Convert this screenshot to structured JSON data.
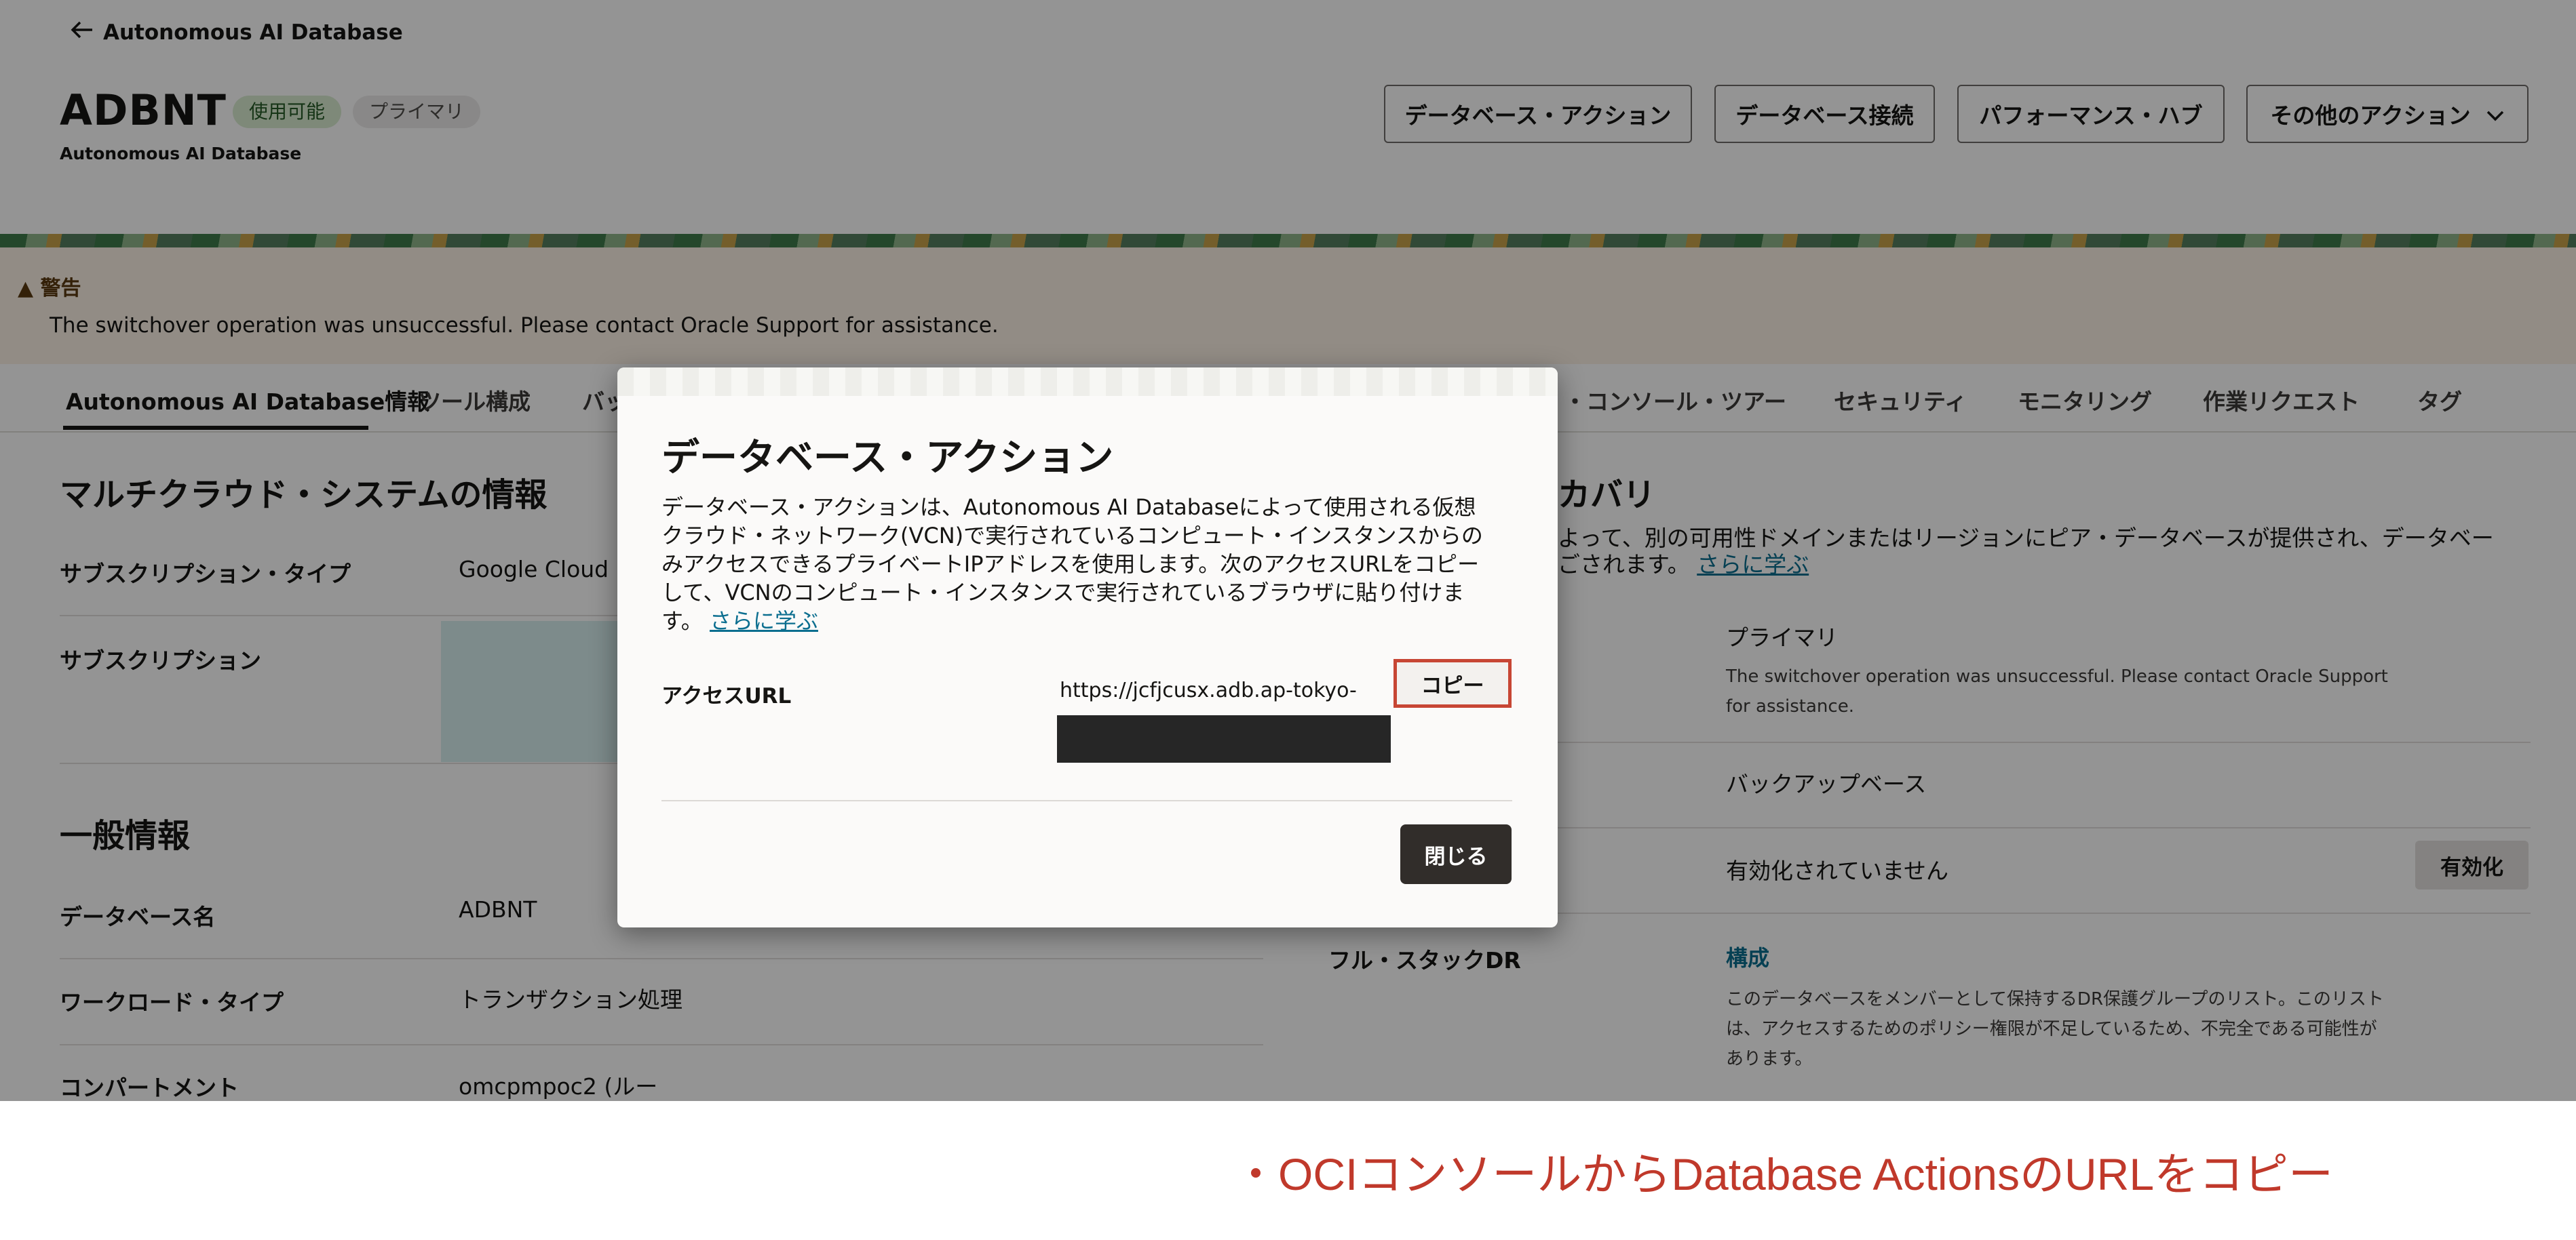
{
  "header": {
    "back_label": "Autonomous AI Database",
    "title": "ADBNT",
    "status_badge": "使用可能",
    "role_badge": "プライマリ",
    "subtitle": "Autonomous AI Database",
    "actions": [
      "データベース・アクション",
      "データベース接続",
      "パフォーマンス・ハブ",
      "その他のアクション"
    ]
  },
  "warning": {
    "title": "警告",
    "message": "The switchover operation was unsuccessful. Please contact Oracle Support for assistance."
  },
  "tabs": [
    "Autonomous AI Database情報",
    "ツール構成",
    "バッ",
    "・コンソール・ツアー",
    "セキュリティ",
    "モニタリング",
    "作業リクエスト",
    "タグ"
  ],
  "left_panel": {
    "multicloud_heading": "マルチクラウド・システムの情報",
    "subscription_type_label": "サブスクリプション・タイプ",
    "subscription_type_value": "Google Cloud",
    "subscription_label": "サブスクリプション",
    "general_heading": "一般情報",
    "rows": [
      {
        "label": "データベース名",
        "value": "ADBNT"
      },
      {
        "label": "ワークロード・タイプ",
        "value": "トランザクション処理"
      },
      {
        "label": "コンパートメント",
        "value": "omcpmpoc2 (ルー"
      }
    ]
  },
  "right_panel": {
    "heading_partial": "カバリ",
    "desc_line1": "よって、別の可用性ドメインまたはリージョンにピア・データベースが提供され、データベー",
    "desc_line2": "ごされます。",
    "learn_more": "さらに学ぶ",
    "role_value": "プライマリ",
    "role_note": "The switchover operation was unsuccessful. Please contact Oracle Support for assistance.",
    "backup_value": "バックアップベース",
    "disabled_value": "有効化されていません",
    "enable_button": "有効化",
    "fullstack_label": "フル・スタックDR",
    "fullstack_link": "構成",
    "fullstack_note": "このデータベースをメンバーとして保持するDR保護グループのリスト。このリストは、アクセスするためのポリシー権限が不足しているため、不完全である可能性があります。"
  },
  "modal": {
    "title": "データベース・アクション",
    "description": "データベース・アクションは、Autonomous AI Databaseによって使用される仮想クラウド・ネットワーク(VCN)で実行されているコンピュート・インスタンスからのみアクセスできるプライベートIPアドレスを使用します。次のアクセスURLをコピーして、VCNのコンピュート・インスタンスで実行されているブラウザに貼り付けます。",
    "learn_more": "さらに学ぶ",
    "access_url_label": "アクセスURL",
    "access_url_value": "https://jcfjcusx.adb.ap-tokyo-",
    "copy_button": "コピー",
    "close_button": "閉じる"
  },
  "caption": "・OCIコンソールからDatabase ActionsのURLをコピー",
  "colors": {
    "highlight": "#c74634",
    "caption": "#c0392b",
    "link": "#0b6e8f"
  }
}
